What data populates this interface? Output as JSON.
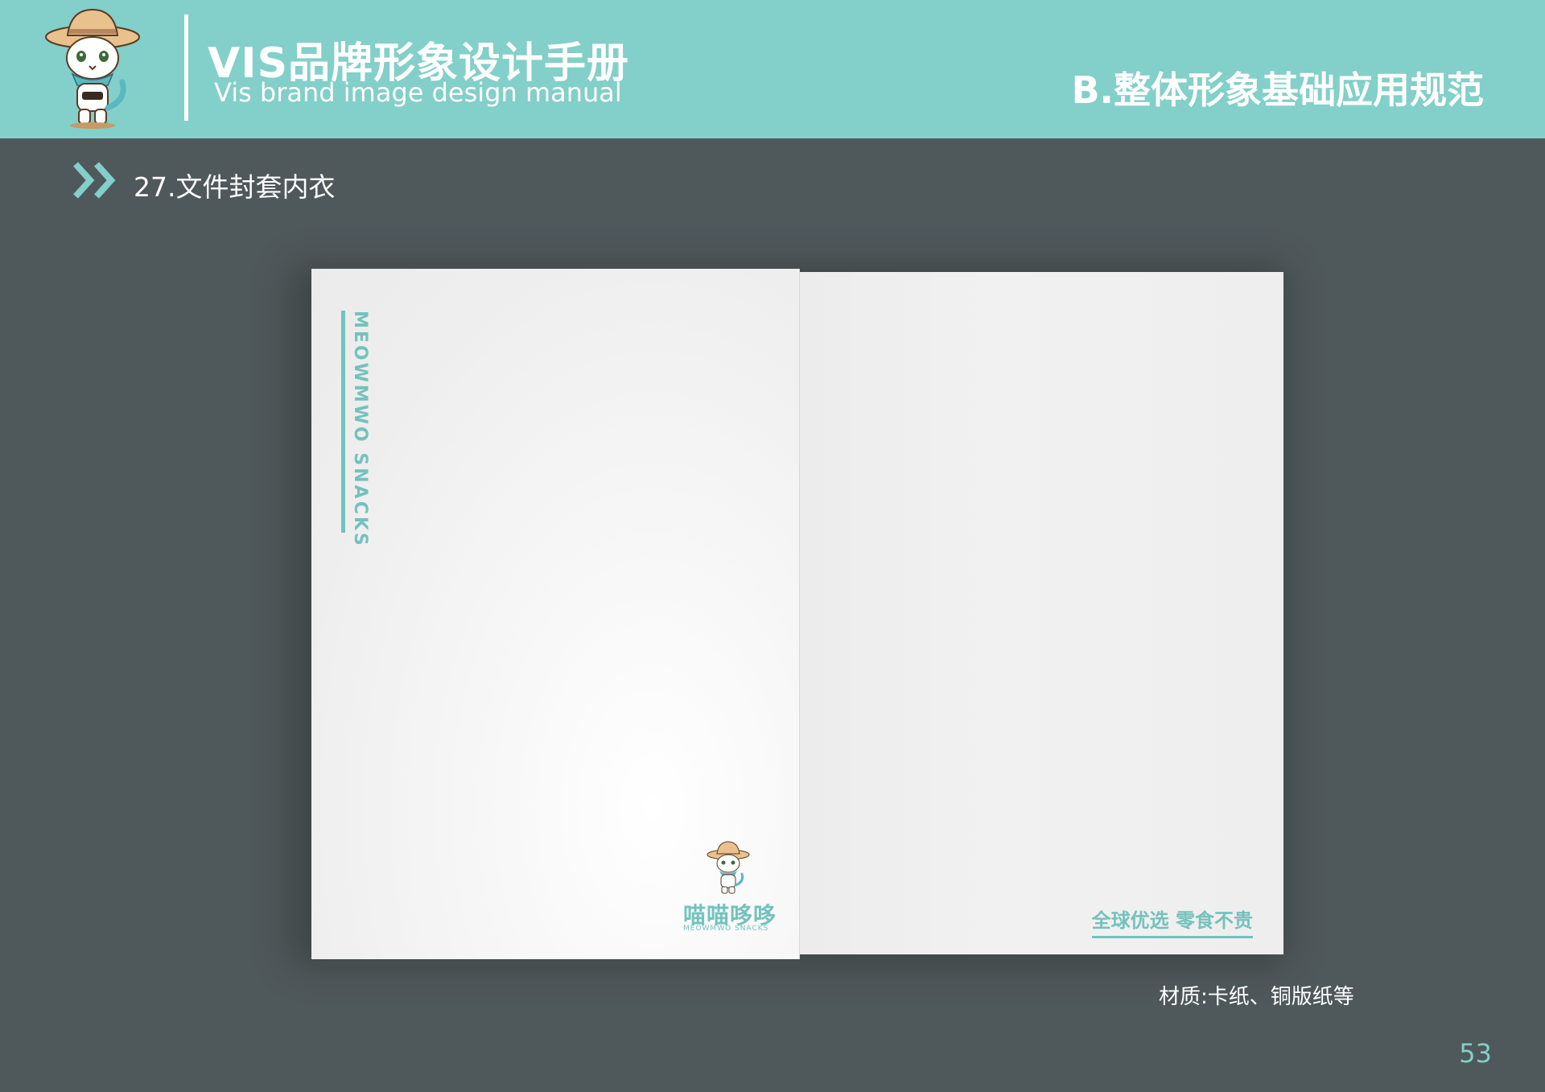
{
  "header": {
    "manual_title": "VIS品牌形象设计手册",
    "manual_subtitle": "Vis brand image design manual",
    "section_title": "B.整体形象基础应用规范"
  },
  "item": {
    "title": "27.文件封套内衣"
  },
  "folder": {
    "vertical_brand": "MEOWMWO SNACKS",
    "brand_name_cn": "喵喵哆哆",
    "brand_name_en": "MEOWMWO SNACKS",
    "slogan": "全球优选 零食不贵"
  },
  "material_note": "材质:卡纸、铜版纸等",
  "page_number": "53",
  "colors": {
    "header_teal": "#83cfc9",
    "brand_teal": "#73c2bd",
    "background": "#4f585a"
  }
}
